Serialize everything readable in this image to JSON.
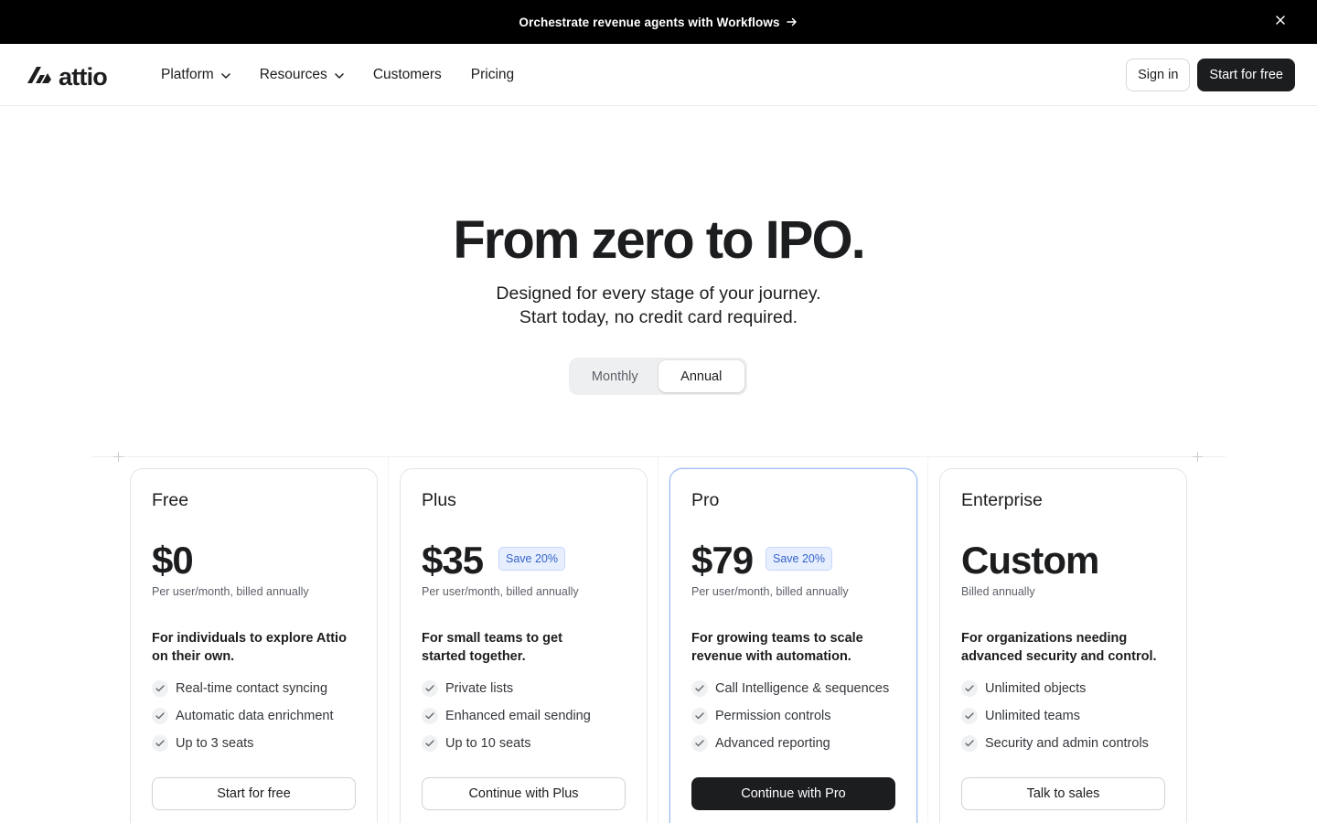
{
  "announcement": {
    "text": "Orchestrate revenue agents with Workflows"
  },
  "header": {
    "logo_text": "attio",
    "nav": [
      {
        "label": "Platform",
        "has_dropdown": true
      },
      {
        "label": "Resources",
        "has_dropdown": true
      },
      {
        "label": "Customers",
        "has_dropdown": false
      },
      {
        "label": "Pricing",
        "has_dropdown": false
      }
    ],
    "sign_in_label": "Sign in",
    "start_label": "Start for free"
  },
  "hero": {
    "title": "From zero to IPO.",
    "subtitle_line1": "Designed for every stage of your journey.",
    "subtitle_line2": "Start today, no credit card required."
  },
  "billing_toggle": {
    "options": [
      "Monthly",
      "Annual"
    ],
    "selected": "Annual"
  },
  "plans": [
    {
      "name": "Free",
      "price": "$0",
      "badge": "",
      "billing": "Per user/month, billed annually",
      "description": "For individuals to explore Attio on their own.",
      "features": [
        "Real-time contact syncing",
        "Automatic data enrichment",
        "Up to 3 seats"
      ],
      "cta": "Start for free"
    },
    {
      "name": "Plus",
      "price": "$35",
      "badge": "Save 20%",
      "billing": "Per user/month, billed annually",
      "description": "For small teams to get started together.",
      "features": [
        "Private lists",
        "Enhanced email sending",
        "Up to 10 seats"
      ],
      "cta": "Continue with Plus"
    },
    {
      "name": "Pro",
      "price": "$79",
      "badge": "Save 20%",
      "billing": "Per user/month, billed annually",
      "description": "For growing teams to scale revenue with automation.",
      "features": [
        "Call Intelligence & sequences",
        "Permission controls",
        "Advanced reporting"
      ],
      "cta": "Continue with Pro"
    },
    {
      "name": "Enterprise",
      "price": "Custom",
      "badge": "",
      "billing": "Billed annually",
      "description": "For organizations needing advanced security and control.",
      "features": [
        "Unlimited objects",
        "Unlimited teams",
        "Security and admin controls"
      ],
      "cta": "Talk to sales"
    }
  ],
  "colors": {
    "announcement_bg": "#000000",
    "primary_dark": "#1c1d1f",
    "badge_bg": "#e7efff",
    "badge_text": "#3463c9",
    "featured_border": "#9dbcf2"
  }
}
